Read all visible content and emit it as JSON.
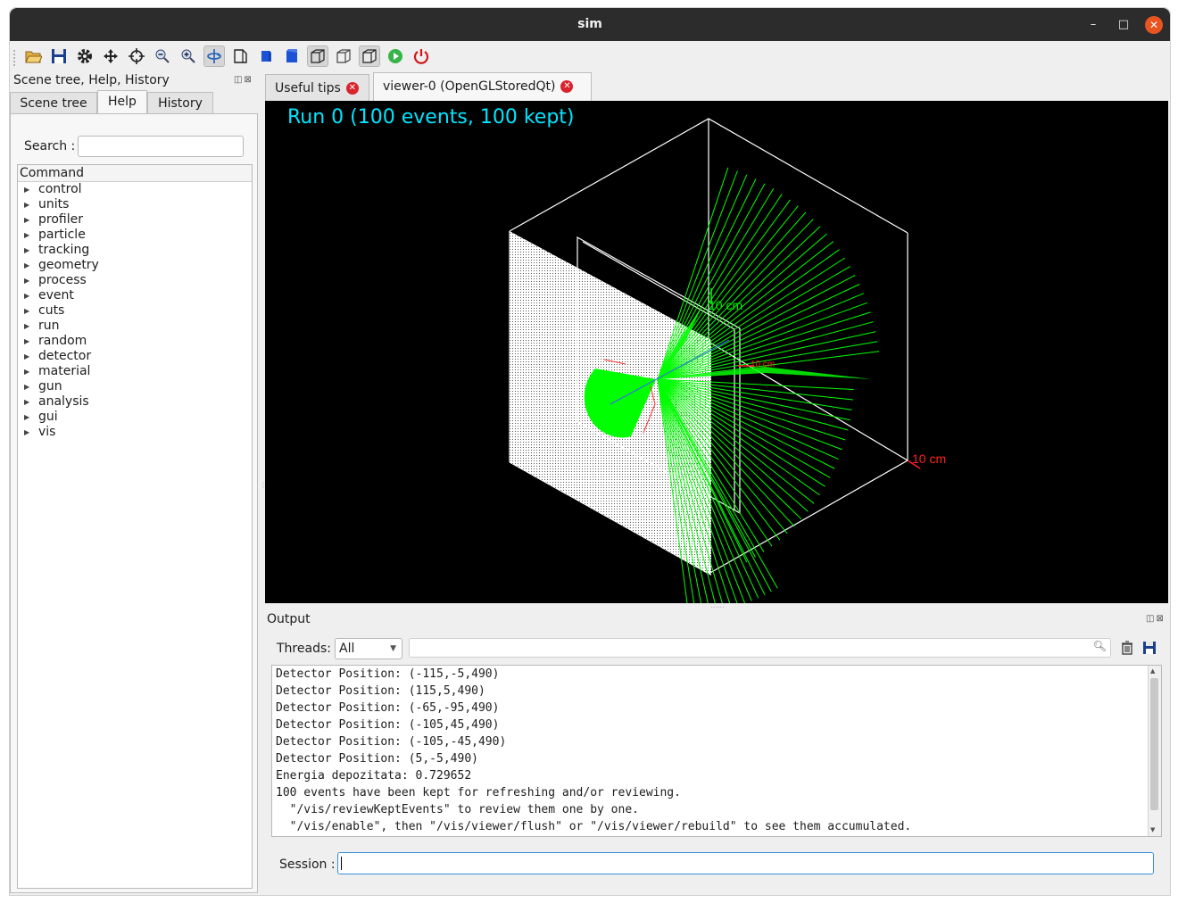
{
  "window": {
    "title": "sim",
    "controls": {
      "minimize": "–",
      "maximize": "□",
      "close": "✕"
    }
  },
  "toolbar": {
    "items": [
      {
        "name": "open-icon"
      },
      {
        "name": "save-icon"
      },
      {
        "name": "settings-icon"
      },
      {
        "name": "move-icon"
      },
      {
        "name": "pick-target-icon"
      },
      {
        "name": "zoom-out-icon"
      },
      {
        "name": "zoom-in-icon"
      },
      {
        "name": "rotate-icon",
        "active": true
      },
      {
        "name": "perspective-icon"
      },
      {
        "name": "solid-blue-icon"
      },
      {
        "name": "solid-blue-2-icon"
      },
      {
        "name": "wireframe-icon",
        "active": true
      },
      {
        "name": "hidden-line-icon"
      },
      {
        "name": "surface-icon",
        "active": true
      },
      {
        "name": "run-beam-icon"
      },
      {
        "name": "power-icon"
      }
    ]
  },
  "left_dock": {
    "title": "Scene tree, Help, History",
    "dock_buttons": "◫⊠",
    "tabs": [
      {
        "label": "Scene tree"
      },
      {
        "label": "Help",
        "active": true
      },
      {
        "label": "History"
      }
    ],
    "search_label": "Search :",
    "search_value": "",
    "tree_header": "Command",
    "tree_items": [
      "control",
      "units",
      "profiler",
      "particle",
      "tracking",
      "geometry",
      "process",
      "event",
      "cuts",
      "run",
      "random",
      "detector",
      "material",
      "gun",
      "analysis",
      "gui",
      "vis"
    ]
  },
  "right_tabs": [
    {
      "label": "Useful tips"
    },
    {
      "label": "viewer-0 (OpenGLStoredQt)",
      "active": true
    }
  ],
  "viewer": {
    "run_label": "Run 0 (100 events, 100 kept)",
    "scale_labels": [
      "10 cm",
      "10 cm",
      "10 cm"
    ],
    "colors": {
      "background": "#000000",
      "tracks": "#00ff00",
      "box": "#ffffff",
      "title": "#00e5ff",
      "axis_x": "#ff2020"
    }
  },
  "output": {
    "title": "Output",
    "dock_buttons": "◫⊠",
    "threads_label": "Threads:",
    "threads_value": "All",
    "filter_value": "",
    "lines": [
      "Detector Position: (-115,-5,490)",
      "Detector Position: (115,5,490)",
      "Detector Position: (-65,-95,490)",
      "Detector Position: (-105,45,490)",
      "Detector Position: (-105,-45,490)",
      "Detector Position: (5,-5,490)",
      "Energia depozitata: 0.729652",
      "100 events have been kept for refreshing and/or reviewing.",
      "  \"/vis/reviewKeptEvents\" to review them one by one.",
      "  \"/vis/enable\", then \"/vis/viewer/flush\" or \"/vis/viewer/rebuild\" to see them accumulated."
    ],
    "session_label": "Session :",
    "session_value": ""
  }
}
